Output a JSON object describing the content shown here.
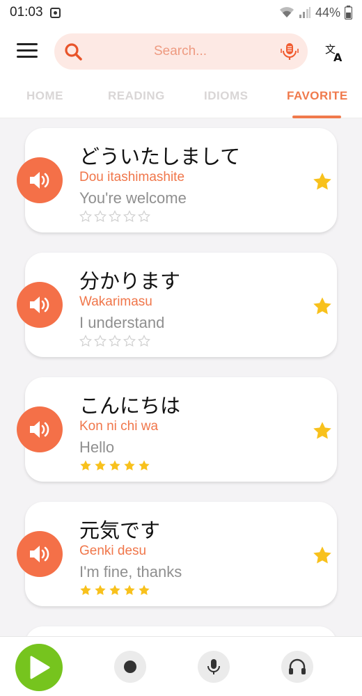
{
  "status_bar": {
    "time": "01:03",
    "battery": "44%"
  },
  "header": {
    "search_placeholder": "Search..."
  },
  "tabs": [
    {
      "label": "HOME",
      "active": false
    },
    {
      "label": "READING",
      "active": false
    },
    {
      "label": "IDIOMS",
      "active": false
    },
    {
      "label": "FAVORITE",
      "active": true
    }
  ],
  "phrases": [
    {
      "japanese": "どういたしまして",
      "romaji": "Dou itashimashite",
      "english": "You're welcome",
      "rating": 0,
      "favorite": true
    },
    {
      "japanese": "分かります",
      "romaji": "Wakarimasu",
      "english": "I understand",
      "rating": 0,
      "favorite": true
    },
    {
      "japanese": "こんにちは",
      "romaji": "Kon ni chi wa",
      "english": "Hello",
      "rating": 5,
      "favorite": true
    },
    {
      "japanese": "元気です",
      "romaji": "Genki desu",
      "english": "I'm fine, thanks",
      "rating": 5,
      "favorite": true
    }
  ],
  "icons": {
    "menu": "hamburger-menu-icon",
    "search": "search-icon",
    "mic": "microphone-icon",
    "translate": "translate-icon",
    "speaker": "speaker-icon",
    "favorite": "star-icon",
    "play": "play-icon",
    "record": "record-icon",
    "voice": "microphone-icon",
    "listen": "headphones-icon"
  },
  "colors": {
    "accent": "#f07a4c",
    "speaker_bg": "#f47048",
    "star_gold": "#f8c11c",
    "play_green": "#76c41e",
    "search_bg": "#fde9e4"
  }
}
